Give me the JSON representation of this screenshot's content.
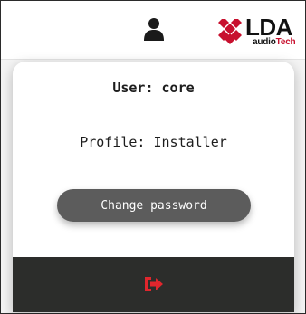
{
  "topbar": {
    "user_icon": "user-icon",
    "logo": {
      "text": "LDA",
      "sub_prefix": "audio",
      "sub_suffix": "Tech",
      "mark_color": "#c8102e"
    }
  },
  "dropdown": {
    "user_line": "User: core",
    "profile_line": "Profile: Installer",
    "change_password_label": "Change password",
    "logout_icon": "logout-icon",
    "logout_color": "#e0262d",
    "footer_color": "#2c2d2b"
  }
}
